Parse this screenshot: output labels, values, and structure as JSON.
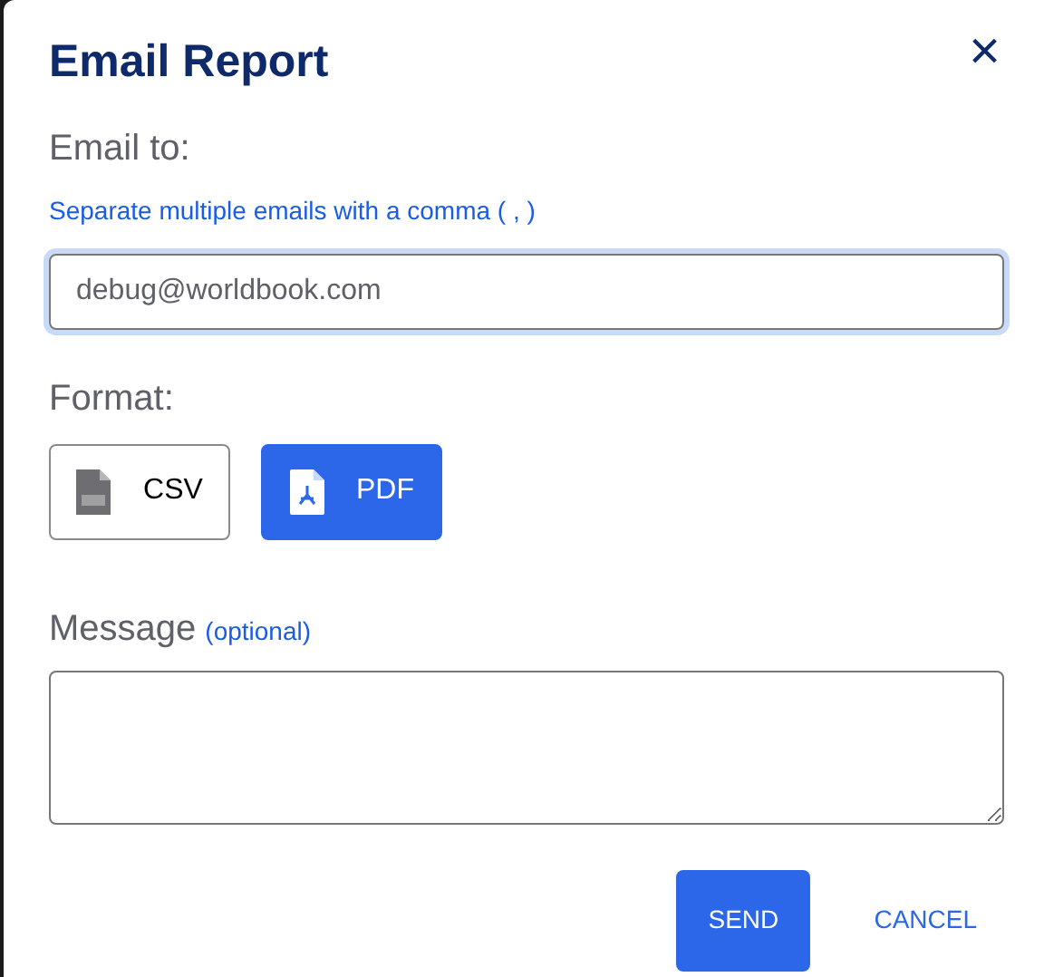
{
  "dialog": {
    "title": "Email Report",
    "close": "×"
  },
  "email": {
    "label": "Email to:",
    "hint": "Separate multiple emails with a comma ( , )",
    "value": "debug@worldbook.com",
    "focused": true
  },
  "format": {
    "label": "Format:",
    "options": [
      {
        "kind": "csv",
        "label": "CSV",
        "selected": false
      },
      {
        "kind": "pdf",
        "label": "PDF",
        "selected": true
      }
    ]
  },
  "message": {
    "label": "Message",
    "note": "(optional)"
  },
  "buttons": [
    {
      "kind": "primary",
      "label": "SEND"
    },
    {
      "kind": "link",
      "label": "CANCEL"
    }
  ]
}
